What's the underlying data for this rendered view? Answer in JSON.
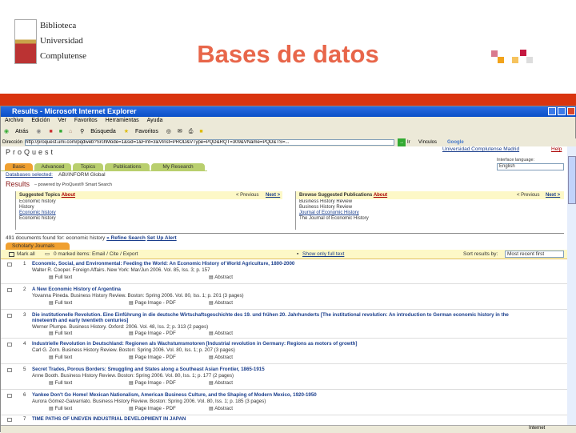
{
  "slide": {
    "logo_lines": [
      "Biblioteca",
      "Universidad",
      "Complutense"
    ],
    "title": "Bases de datos"
  },
  "browser": {
    "title": "Results - Microsoft Internet Explorer",
    "menu": [
      "Archivo",
      "Edición",
      "Ver",
      "Favoritos",
      "Herramientas",
      "Ayuda"
    ],
    "toolbar": [
      "Atrás",
      "Búsqueda",
      "Favoritos"
    ],
    "address_label": "Dirección",
    "address": "http://proquest.umi.com/pqdweb?SrchMode=1&sid=1&Fmt=3&VInst=PROD&VType=PQD&RQT=309&VName=PQD&TS=...",
    "go": "Ir",
    "links": "Vínculos",
    "google": "Google"
  },
  "proquest": {
    "brand": "ProQuest",
    "top_links": [
      "Universidad Complutense Madrid",
      "Help"
    ],
    "language_label": "Interface language:",
    "language": "English",
    "tabs": [
      "Basic",
      "Advanced",
      "Topics",
      "Publications",
      "My Research"
    ],
    "databases_selected": "Databases selected:",
    "databases_value": "ABI/INFORM Global",
    "results_title": "Results",
    "results_sub": "– powered by ProQuest® Smart Search",
    "suggested_topics": {
      "title": "Suggested Topics",
      "about": "About",
      "previous": "< Previous",
      "next": "Next >",
      "items": [
        "Economic history",
        "History",
        "Economic history",
        "Economic history"
      ]
    },
    "suggested_pubs": {
      "title": "Browse Suggested Publications",
      "about": "About",
      "previous": "< Previous",
      "next": "Next >",
      "items": [
        "Business History Review",
        "Business History Review",
        "Journal of Economic History",
        "The Journal of Economic History"
      ]
    },
    "summary": "491 documents found for: economic history",
    "refine": "» Refine Search",
    "alert": "Set Up Alert",
    "scholarly": "Scholarly Journals",
    "mark_all": "Mark all",
    "marked_items": "0 marked items: Email / Cite / Export",
    "show_only": "Show only full text",
    "sort_label": "Sort results by:",
    "sort_value": "Most recent first",
    "results": [
      {
        "n": "1",
        "title": "Economic, Social, and Environmental: Feeding the World: An Economic History of World Agriculture, 1800-2000",
        "source": "Walter R. Cooper. Foreign Affairs. New York: Mar/Jun 2006. Vol. 85, Iss. 3; p. 157",
        "opts": [
          "Full text",
          "",
          "Abstract"
        ]
      },
      {
        "n": "2",
        "title": "A New Economic History of Argentina",
        "source": "Yovanna Pineda. Business History Review. Boston: Spring 2006. Vol. 80, Iss. 1; p. 201 (3 pages)",
        "opts": [
          "Full text",
          "Page Image - PDF",
          "Abstract"
        ]
      },
      {
        "n": "3",
        "title": "Die institutionelle Revolution. Eine Einführung in die deutsche Wirtschaftsgeschichte des 19. und frühen 20. Jahrhunderts [The institutional revolution: An introduction to German economic history in the nineteenth and early twentieth centuries]",
        "source": "Werner Plumpe. Business History. Oxford: 2006. Vol. 48, Iss. 2; p. 313 (2 pages)",
        "opts": [
          "Full text",
          "Page Image - PDF",
          "Abstract"
        ]
      },
      {
        "n": "4",
        "title": "Industrielle Revolution in Deutschland: Regionen als Wachstumsmotoren [Industrial revolution in Germany: Regions as motors of growth]",
        "source": "Carl G. Zorn. Business History Review. Boston: Spring 2006. Vol. 80, Iss. 1; p. 207 (3 pages)",
        "opts": [
          "Full text",
          "Page Image - PDF",
          "Abstract"
        ]
      },
      {
        "n": "5",
        "title": "Secret Trades, Porous Borders: Smuggling and States along a Southeast Asian Frontier, 1865-1915",
        "source": "Anne Booth. Business History Review. Boston: Spring 2006. Vol. 80, Iss. 1; p. 177 (2 pages)",
        "opts": [
          "Full text",
          "Page Image - PDF",
          "Abstract"
        ]
      },
      {
        "n": "6",
        "title": "Yankee Don't Go Home! Mexican Nationalism, American Business Culture, and the Shaping of Modern Mexico, 1920-1950",
        "source": "Aurora Gómez-Galvarriato. Business History Review. Boston: Spring 2006. Vol. 80, Iss. 1; p. 185 (3 pages)",
        "opts": [
          "Full text",
          "Page Image - PDF",
          "Abstract"
        ]
      },
      {
        "n": "7",
        "title": "TIME PATHS OF UNEVEN INDUSTRIAL DEVELOPMENT IN JAPAN",
        "source": "",
        "opts": []
      }
    ],
    "status": "Internet"
  }
}
